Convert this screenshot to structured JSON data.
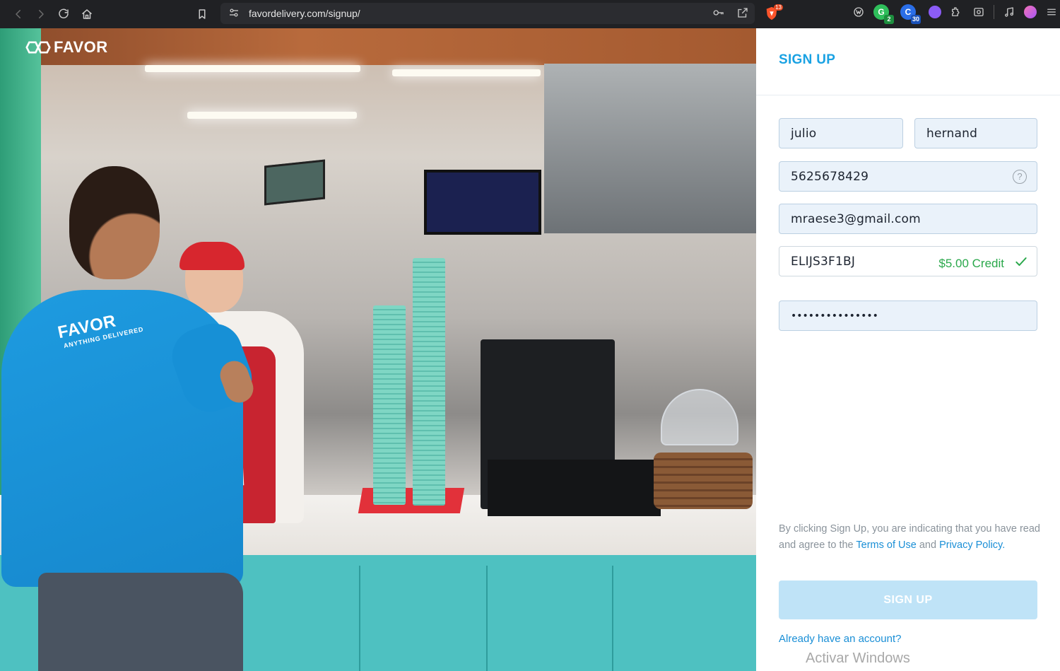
{
  "browser": {
    "url": "favordelivery.com/signup/",
    "brave_badge": "13",
    "extensions": [
      {
        "name": "green-ext",
        "badge": "2",
        "color": "#2fbf5b",
        "badge_color": "#1d8f3e"
      },
      {
        "name": "blue-ext",
        "badge": "30",
        "color": "#2a6ee8",
        "badge_color": "#1a52b8"
      },
      {
        "name": "purple-ext",
        "badge": "",
        "color": "#8b5cf6",
        "badge_color": ""
      }
    ]
  },
  "hero": {
    "brand": "FAVOR",
    "shirt_brand": "FAVOR",
    "shirt_tagline": "ANYTHING DELIVERED"
  },
  "signup": {
    "title": "SIGN UP",
    "first_name": "julio",
    "last_name": "hernand",
    "phone": "5625678429",
    "phone_help": "?",
    "email": "mraese3@gmail.com",
    "promo_code": "ELIJS3F1BJ",
    "promo_credit": "$5.00 Credit",
    "password": "•••••••••••••••",
    "legal_prefix": "By clicking Sign Up, you are indicating that you have read and agree to the ",
    "terms_link": "Terms of Use",
    "legal_and": " and ",
    "privacy_link": "Privacy Policy",
    "legal_suffix": ".",
    "button": "SIGN UP",
    "login_link": "Already have an account?"
  },
  "os_watermark": "Activar Windows",
  "colors": {
    "accent": "#1aa2e3",
    "success": "#2aa84b",
    "button_disabled": "#bfe3f7",
    "field_bg": "#eaf2fa"
  }
}
